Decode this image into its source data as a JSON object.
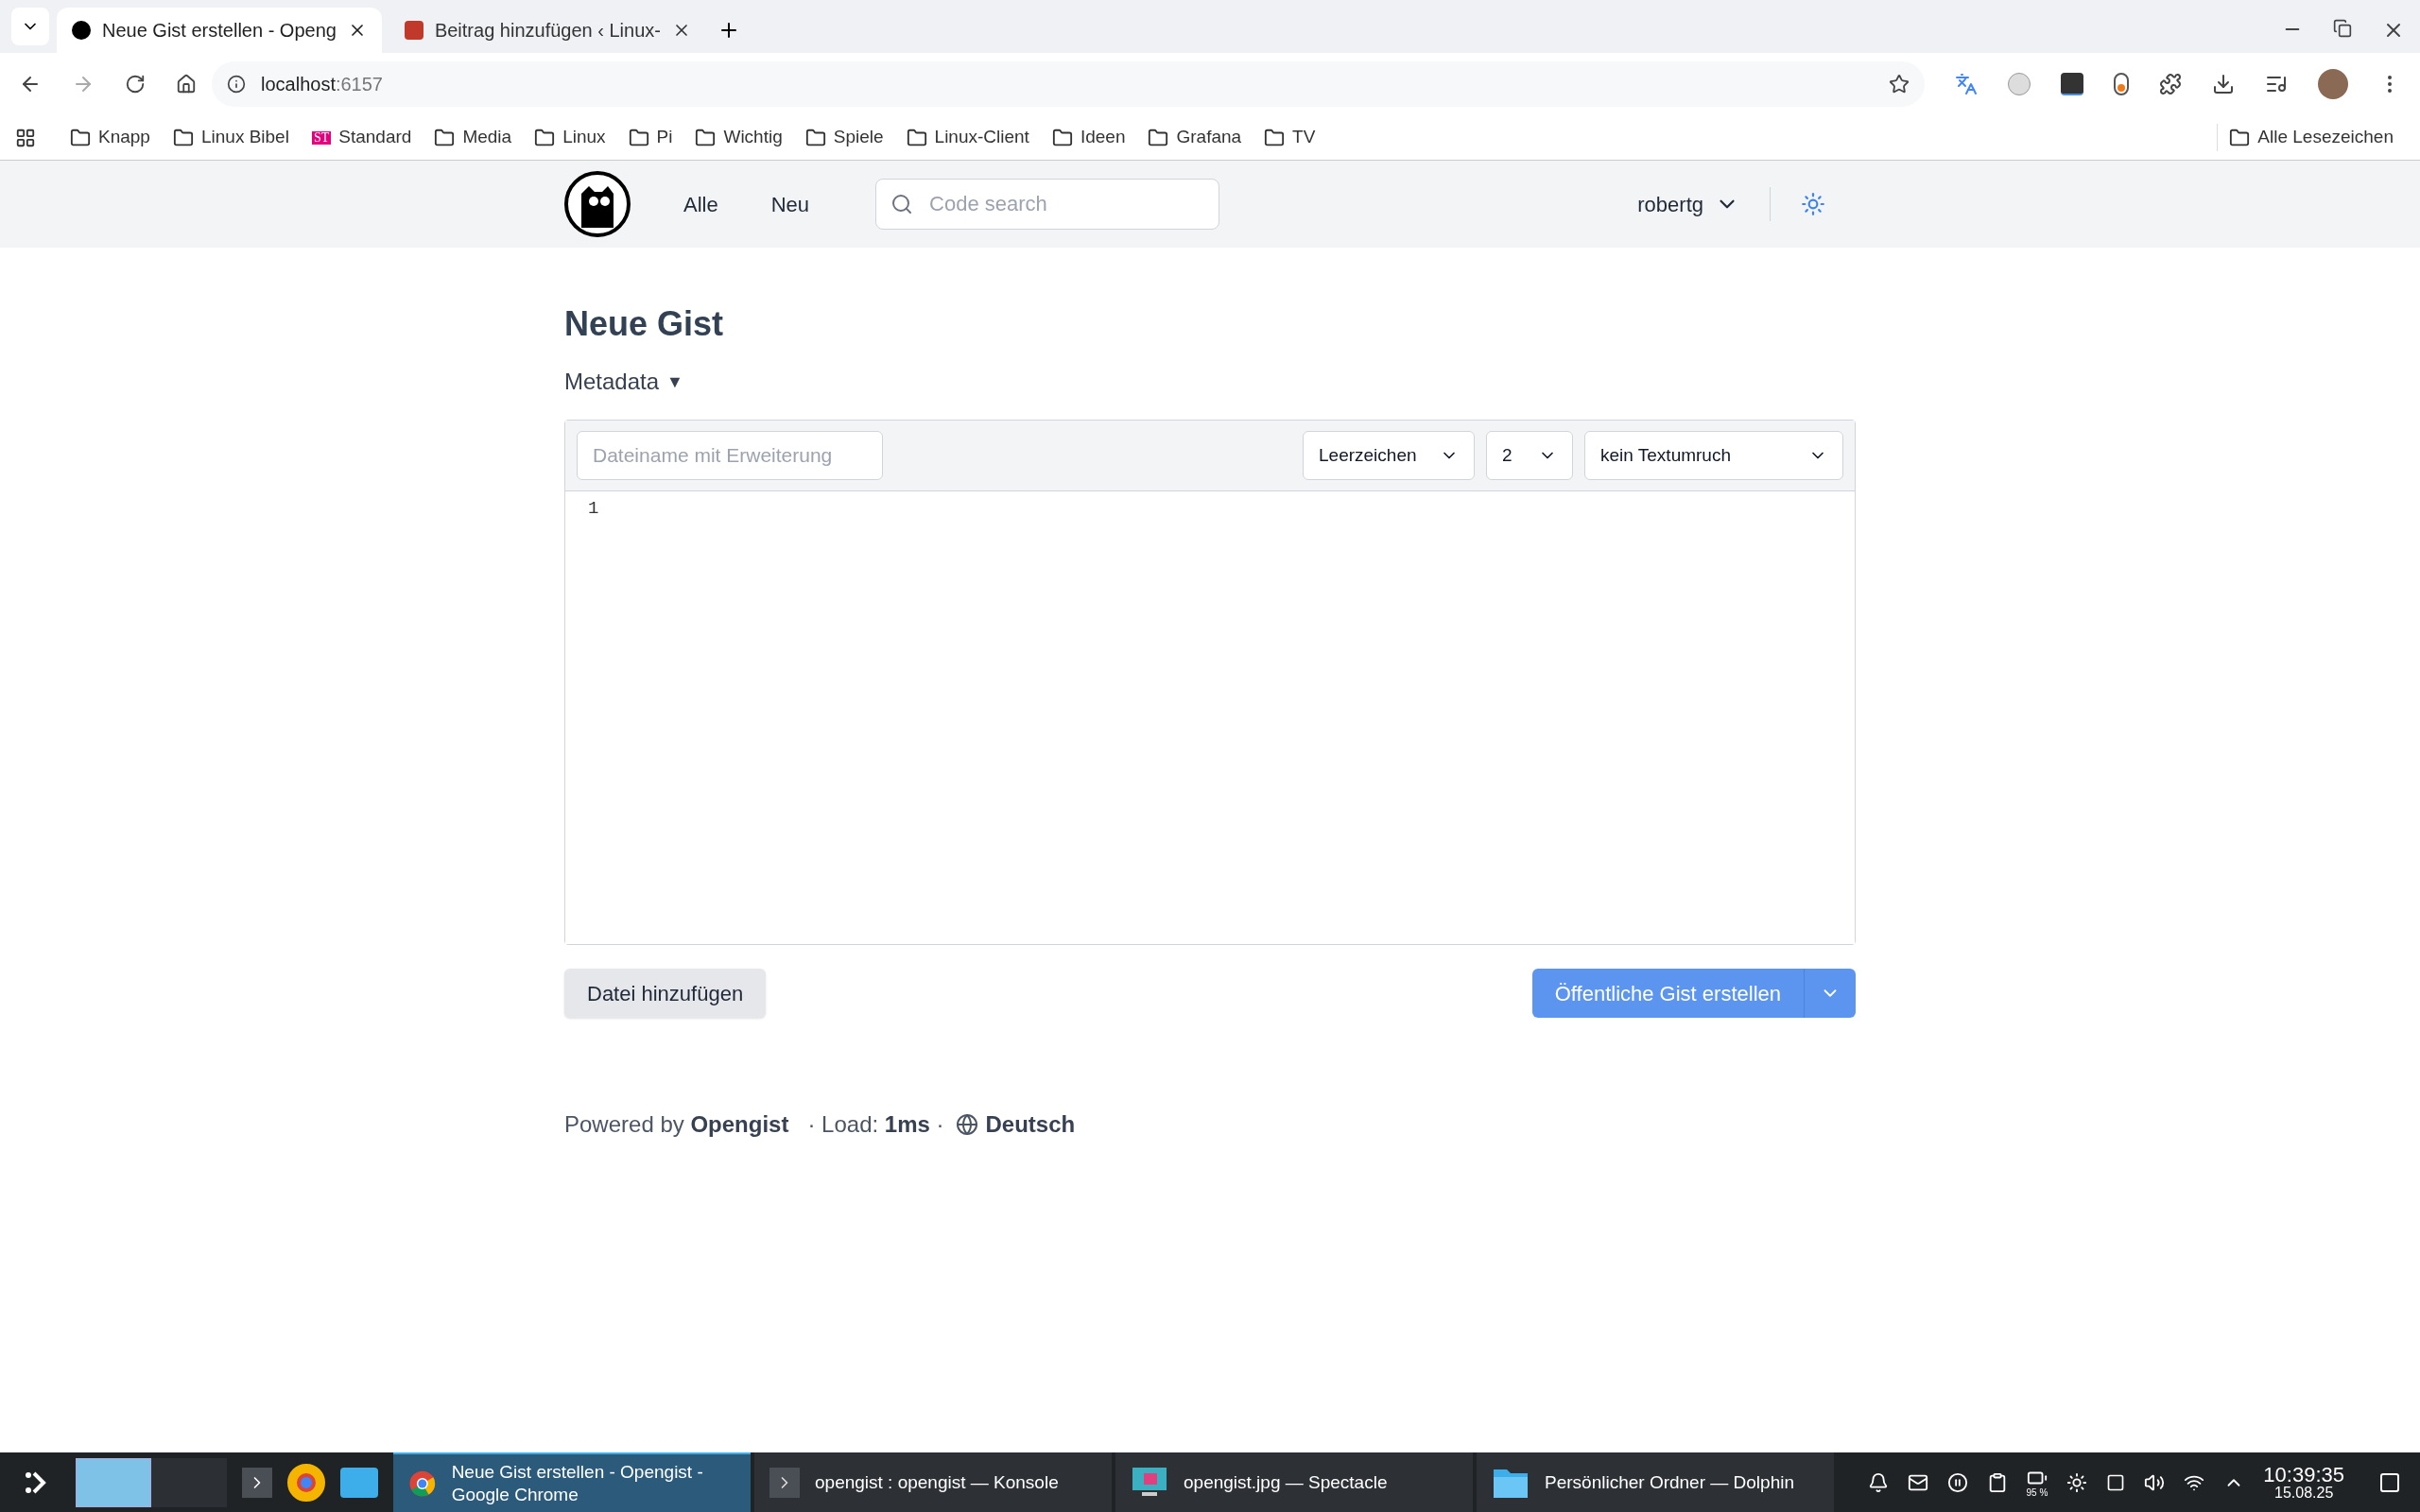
{
  "browser": {
    "tabs": [
      {
        "title": "Neue Gist erstellen - Openg",
        "selected": true,
        "kind": "opengist"
      },
      {
        "title": "Beitrag hinzufügen ‹ Linux-",
        "selected": false,
        "kind": "linux"
      }
    ],
    "address": {
      "host": "localhost",
      "port": ":6157"
    },
    "bookmarks": [
      {
        "label": "Knapp",
        "kind": "folder"
      },
      {
        "label": "Linux Bibel",
        "kind": "folder"
      },
      {
        "label": "Standard",
        "kind": "site"
      },
      {
        "label": "Media",
        "kind": "folder"
      },
      {
        "label": "Linux",
        "kind": "folder"
      },
      {
        "label": "Pi",
        "kind": "folder"
      },
      {
        "label": "Wichtig",
        "kind": "folder"
      },
      {
        "label": "Spiele",
        "kind": "folder"
      },
      {
        "label": "Linux-Client",
        "kind": "folder"
      },
      {
        "label": "Ideen",
        "kind": "folder"
      },
      {
        "label": "Grafana",
        "kind": "folder"
      },
      {
        "label": "TV",
        "kind": "folder"
      }
    ],
    "all_bookmarks": "Alle Lesezeichen",
    "site_logo_text": "ST"
  },
  "site": {
    "nav": [
      "Alle",
      "Neu"
    ],
    "search": {
      "placeholder": "Code search"
    },
    "user": "robertg"
  },
  "heading": "Neue Gist",
  "metadata": {
    "label": "Metadata",
    "toggle": "▼"
  },
  "editor": {
    "filename": {
      "placeholder": "Dateiname mit Erweiterung"
    },
    "selects": [
      "Leerzeichen",
      "2",
      "kein Textumruch"
    ],
    "line_numbers": [
      "1"
    ]
  },
  "buttons": {
    "add_file": "Datei hinzufügen",
    "create": "Öffentliche Gist erstellen"
  },
  "footer": {
    "powered": "Powered by **Opengist**",
    "load": "· Load: **1ms** ·",
    "language": "Deutsch"
  },
  "taskbar": {
    "tasks": [
      {
        "title": "Neue Gist erstellen - Opengist - Google Chrome",
        "selected": true,
        "kind": "chrome"
      },
      {
        "title": "opengist : opengist — Konsole",
        "selected": false,
        "kind": "terminal"
      },
      {
        "title": "opengist.jpg — Spectacle",
        "selected": false,
        "kind": "spectacle"
      },
      {
        "title": "Persönlicher Ordner — Dolphin",
        "selected": false,
        "kind": "folder"
      }
    ],
    "battery": "95 %",
    "time": "10:39:35",
    "date": "15.08.25"
  }
}
